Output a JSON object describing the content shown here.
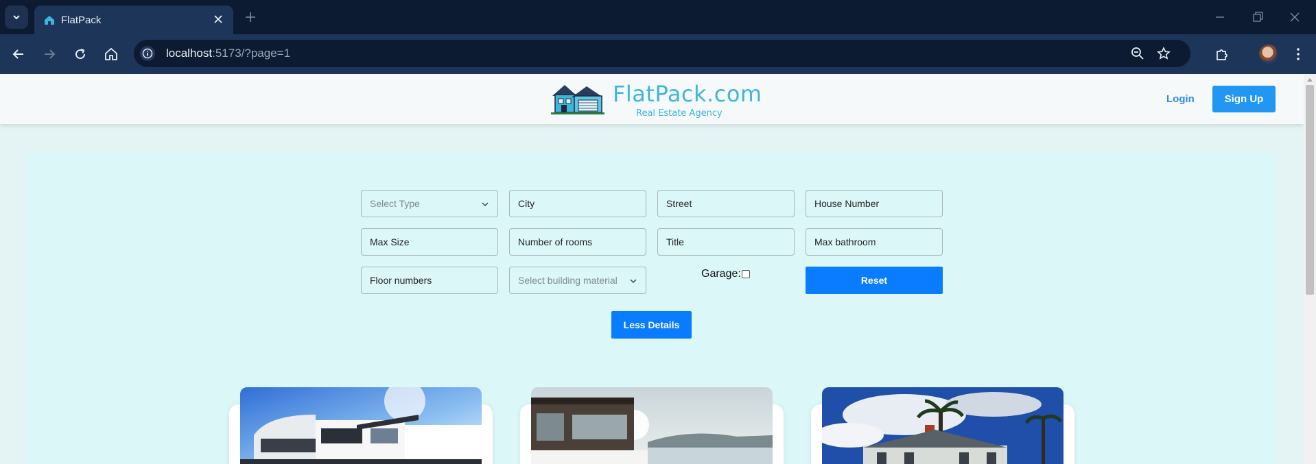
{
  "browser": {
    "tab_title": "FlatPack",
    "url_host": "localhost",
    "url_rest": ":5173/?page=1"
  },
  "header": {
    "logo_text": "FlatPack.com",
    "logo_subtitle": "Real Estate Agency",
    "login_label": "Login",
    "signup_label": "Sign Up"
  },
  "filters": {
    "select_type_placeholder": "Select Type",
    "city_placeholder": "City",
    "street_placeholder": "Street",
    "house_number_placeholder": "House Number",
    "max_size_placeholder": "Max Size",
    "rooms_placeholder": "Number of rooms",
    "title_placeholder": "Title",
    "max_bathroom_placeholder": "Max bathroom",
    "floor_numbers_placeholder": "Floor numbers",
    "building_material_placeholder": "Select building material",
    "garage_label": "Garage:",
    "garage_checked": false,
    "reset_label": "Reset",
    "less_details_label": "Less Details"
  },
  "listings": [
    {
      "image": "modern-white-villa"
    },
    {
      "image": "waterfront-stone-house"
    },
    {
      "image": "victorian-mansion-palms"
    }
  ],
  "colors": {
    "accent": "#0a7cff",
    "signup": "#2196f3",
    "logo": "#3fb5dc",
    "page_bg": "#e4f3f3",
    "panel_bg": "#dcf7f8"
  }
}
